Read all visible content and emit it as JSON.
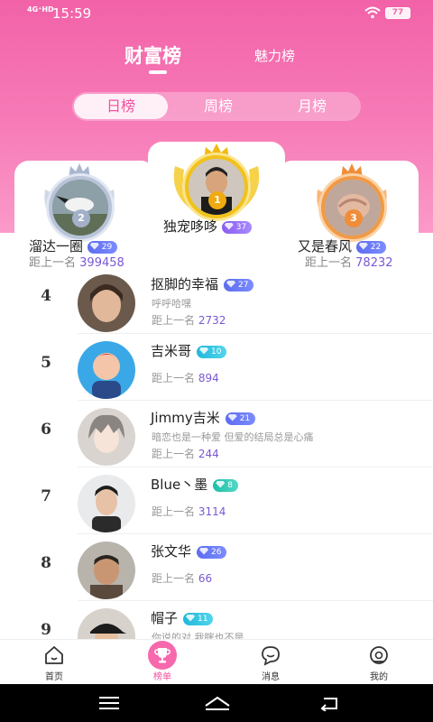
{
  "status_bar": {
    "network": "4G⁺HD",
    "time": "15:59",
    "battery": "77"
  },
  "tabs": {
    "active": "财富榜",
    "inactive": "魅力榜"
  },
  "period_tabs": {
    "day": "日榜",
    "week": "周榜",
    "month": "月榜",
    "selected": "日榜"
  },
  "podium": {
    "first": {
      "rank": "1",
      "name": "独宠哆哆",
      "level": "37"
    },
    "second": {
      "rank": "2",
      "name": "溜达一圈",
      "level": "29",
      "dist_label": "距上一名",
      "dist_value": "399458"
    },
    "third": {
      "rank": "3",
      "name": "又是春风",
      "level": "22",
      "dist_label": "距上一名",
      "dist_value": "78232"
    }
  },
  "list": [
    {
      "rank": "4",
      "name": "抠脚的幸福",
      "level": "27",
      "signature": "呼呼哈嘿",
      "dist_label": "距上一名",
      "dist_value": "2732"
    },
    {
      "rank": "5",
      "name": "吉米哥",
      "level": "10",
      "signature": "",
      "dist_label": "距上一名",
      "dist_value": "894"
    },
    {
      "rank": "6",
      "name": "Jimmy吉米",
      "level": "21",
      "signature": "暗恋也是一种爱 但爱的结局总是心痛",
      "dist_label": "距上一名",
      "dist_value": "244"
    },
    {
      "rank": "7",
      "name": "Blue丶墨",
      "level": "8",
      "signature": "",
      "dist_label": "距上一名",
      "dist_value": "3114"
    },
    {
      "rank": "8",
      "name": "张文华",
      "level": "26",
      "signature": "",
      "dist_label": "距上一名",
      "dist_value": "66"
    },
    {
      "rank": "9",
      "name": "帽子",
      "level": "11",
      "signature": "你说的对 我瞎也不是"
    }
  ],
  "tabbar": {
    "home": "首页",
    "rank": "榜单",
    "messages": "消息",
    "mine": "我的",
    "active": "榜单"
  }
}
